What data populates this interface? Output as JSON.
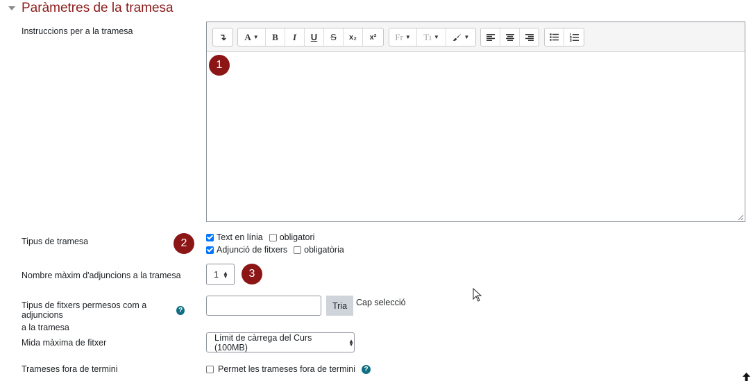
{
  "section": {
    "title": "Paràmetres de la tramesa"
  },
  "editor": {
    "label": "Instruccions per a la tramesa",
    "toolbar": {
      "collapse": "↴",
      "font_color": "A",
      "bold": "B",
      "italic": "I",
      "underline": "U",
      "strike": "S",
      "subscript": "x₂",
      "superscript": "x²",
      "font_family": "Fr",
      "font_size": "Tı",
      "align_left": "≡",
      "align_center": "≡",
      "align_right": "≡",
      "bullet_list": "☰",
      "numbered_list": "☰"
    }
  },
  "markers": {
    "m1": "1",
    "m2": "2",
    "m3": "3"
  },
  "submission_types": {
    "label": "Tipus de tramesa",
    "online_text": {
      "label": "Text en línia",
      "checked": true,
      "required_label": "obligatori",
      "required_checked": false
    },
    "file_upload": {
      "label": "Adjunció de fitxers",
      "checked": true,
      "required_label": "obligatòria",
      "required_checked": false
    }
  },
  "max_files": {
    "label": "Nombre màxim d'adjuncions a la tramesa",
    "value": "1"
  },
  "file_types": {
    "label_line1": "Tipus de fitxers permesos com a adjuncions",
    "label_line2": "a la tramesa",
    "value": "",
    "button": "Tria",
    "status": "Cap selecció",
    "help_icon": "question-circle-icon"
  },
  "max_size": {
    "label": "Mida màxima de fitxer",
    "value": "Límit de càrrega del Curs (100MB)"
  },
  "late": {
    "label": "Trameses fora de termini",
    "checkbox_label": "Permet les trameses fora de termini",
    "checked": false
  },
  "colors": {
    "title": "#8b1a1a",
    "marker": "#8c1515",
    "help": "#0f6e84",
    "checkbox": "#0075ff"
  }
}
